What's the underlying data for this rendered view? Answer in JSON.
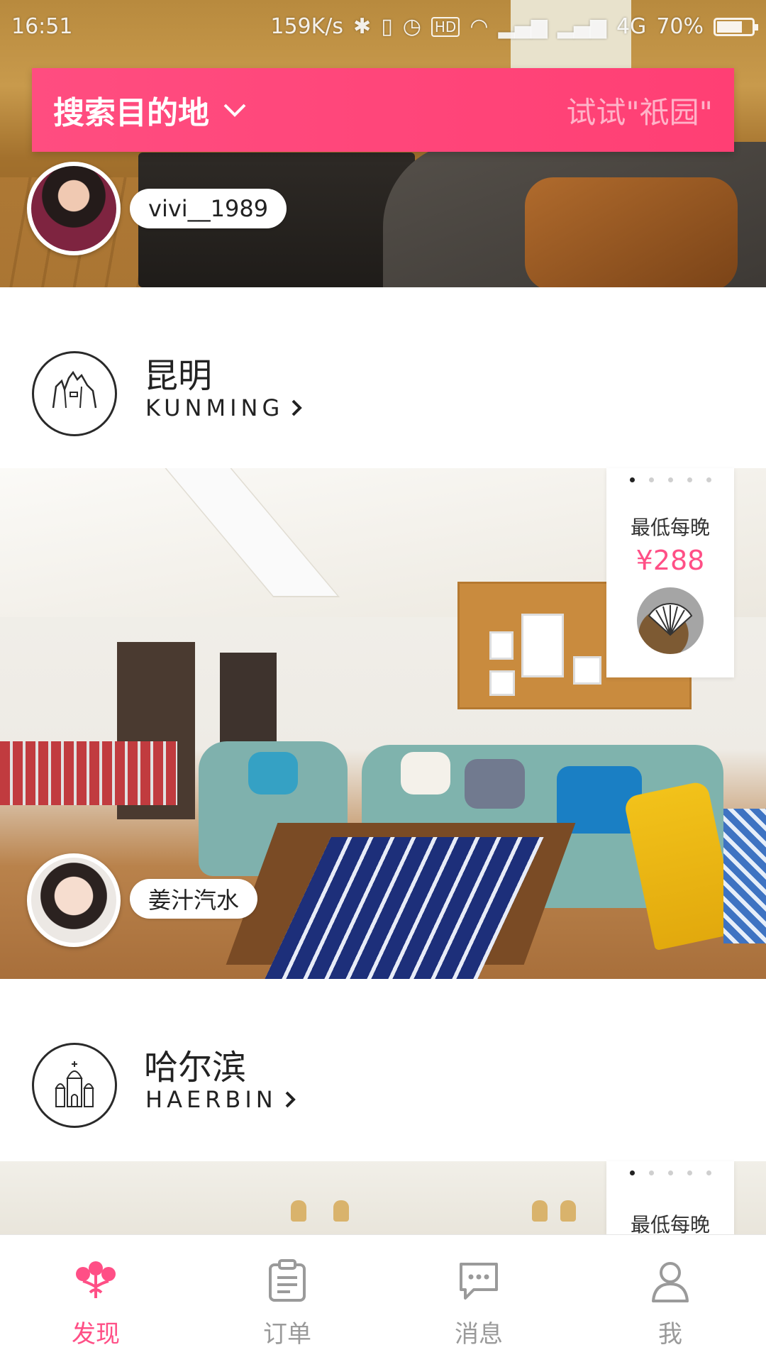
{
  "status_bar": {
    "time": "16:51",
    "net_speed": "159K/s",
    "network": "4G",
    "battery": "70%"
  },
  "search": {
    "label": "搜索目的地",
    "hint": "试试\"祇园\""
  },
  "listings": [
    {
      "host": "vivi__1989"
    },
    {
      "host": "姜汁汽水",
      "price_label": "最低每晚",
      "price": "¥288"
    }
  ],
  "cities": [
    {
      "name": "昆明",
      "name_en": "KUNMING"
    },
    {
      "name": "哈尔滨",
      "name_en": "HAERBIN"
    }
  ],
  "second_card_price_label": "最低每晚",
  "nav": [
    {
      "label": "发现",
      "icon": "flower-icon",
      "active": true
    },
    {
      "label": "订单",
      "icon": "clipboard-icon",
      "active": false
    },
    {
      "label": "消息",
      "icon": "chat-bubble-icon",
      "active": false
    },
    {
      "label": "我",
      "icon": "person-icon",
      "active": false
    }
  ],
  "colors": {
    "accent": "#ff4f86",
    "search_bar": "#ff4578",
    "inactive": "#9a9a9a"
  }
}
